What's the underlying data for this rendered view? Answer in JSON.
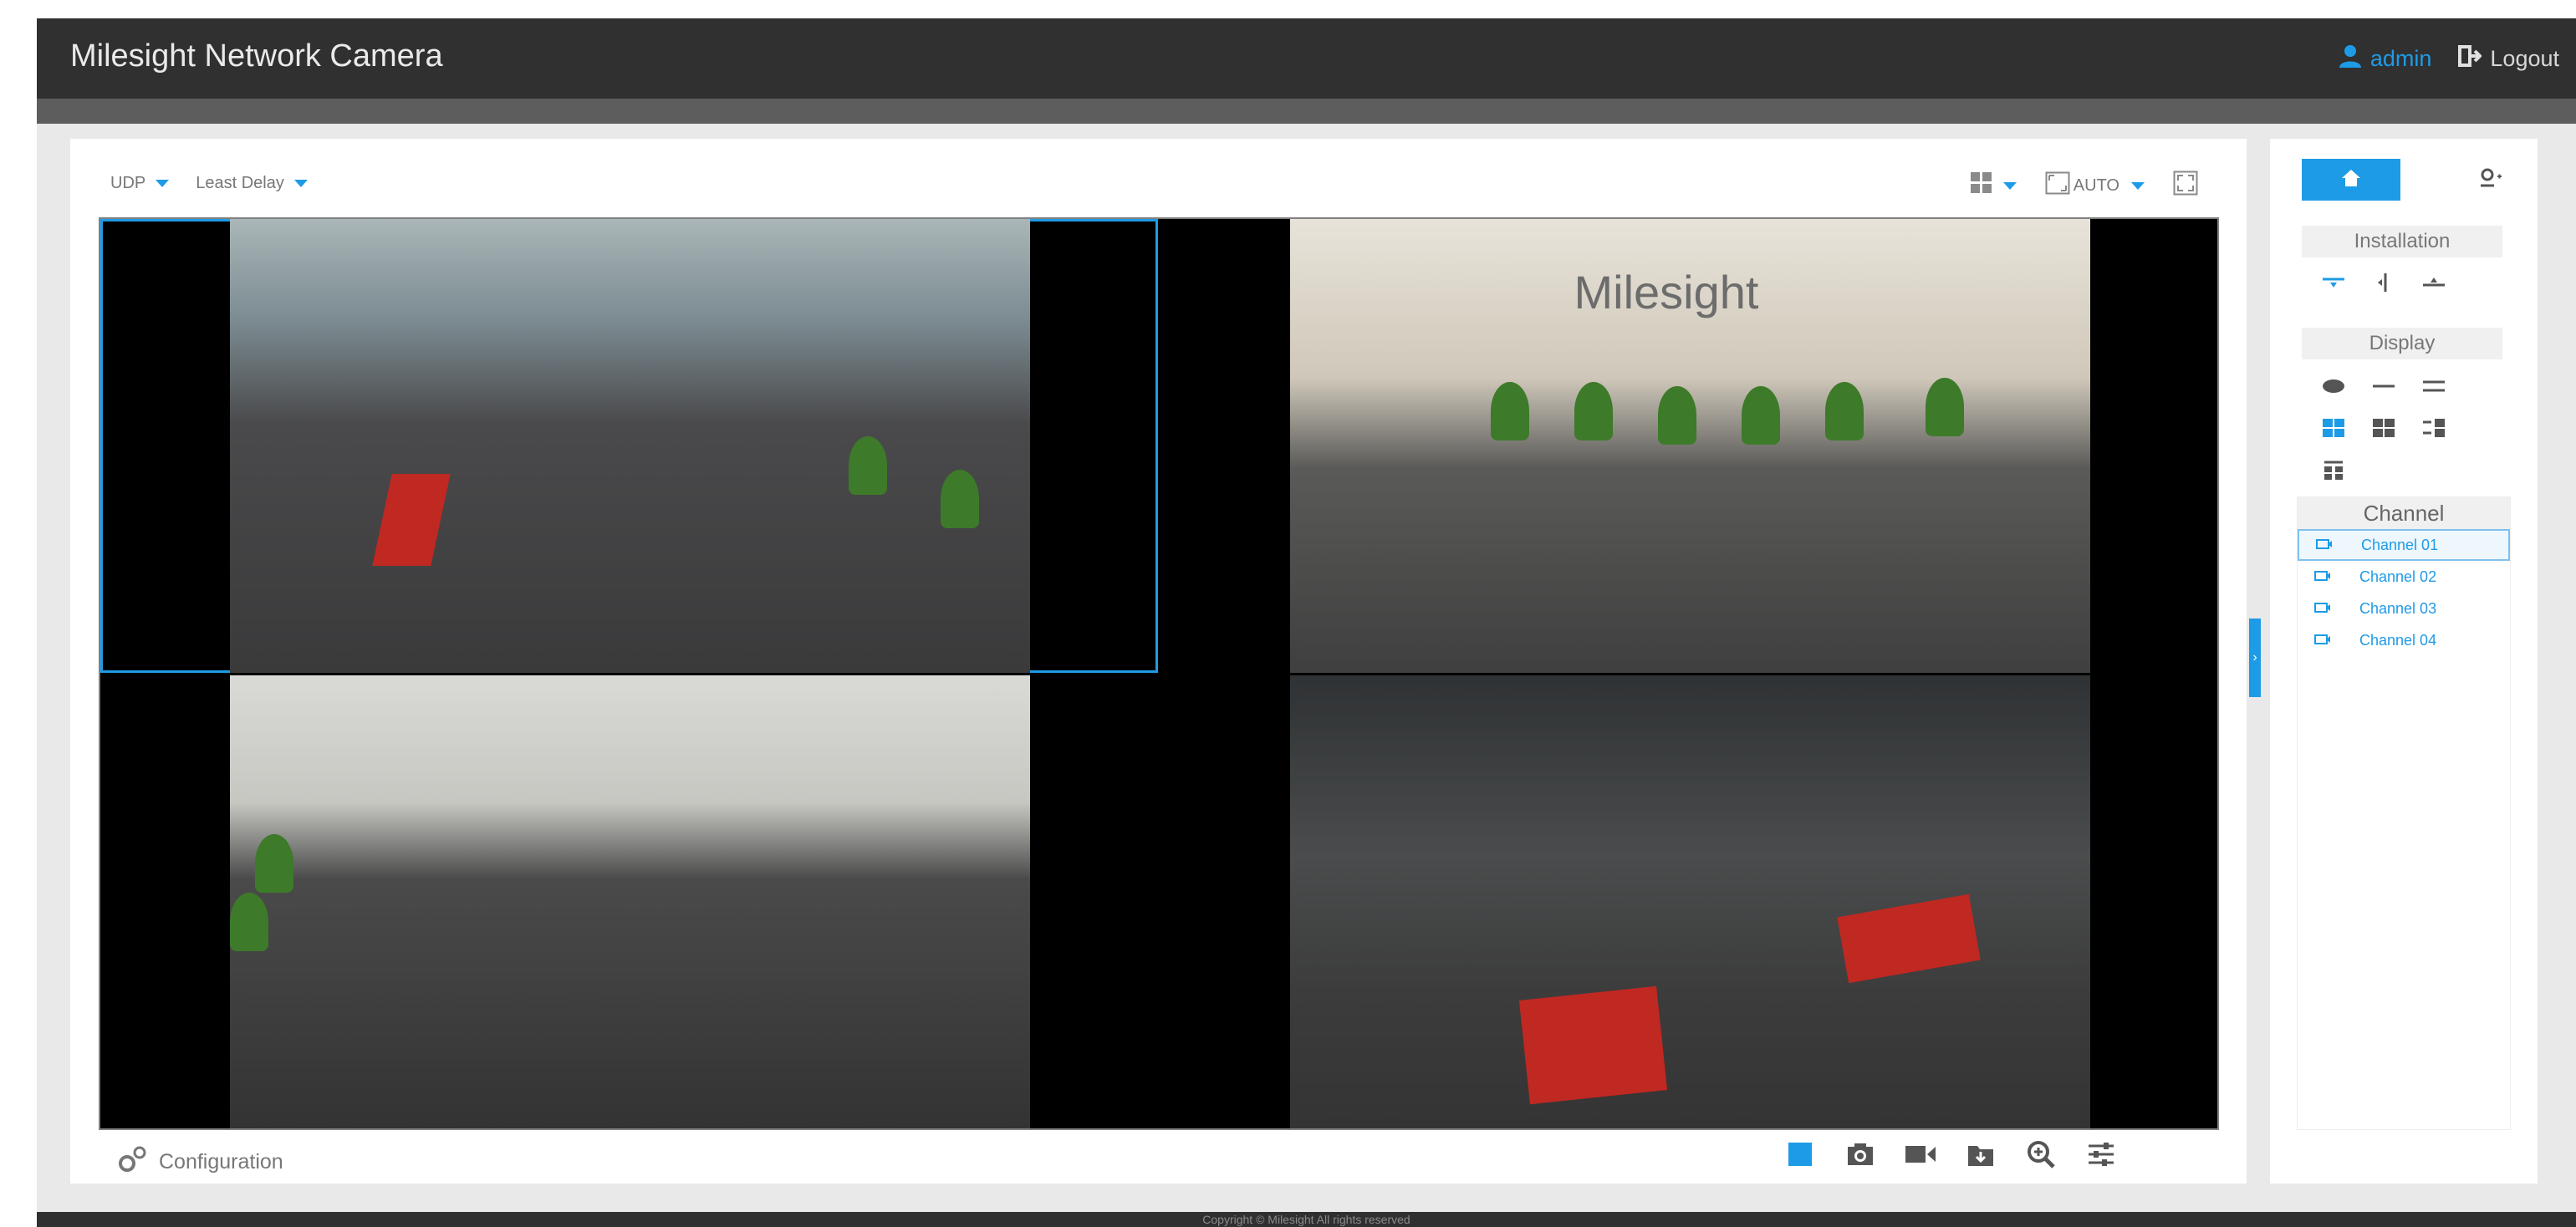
{
  "header": {
    "title": "Milesight Network Camera",
    "user_label": "admin",
    "logout_label": "Logout"
  },
  "toolbar": {
    "protocol": "UDP",
    "delay_mode": "Least Delay",
    "scale_mode": "AUTO"
  },
  "feeds": [
    {
      "channel": "Channel 01",
      "selected": true
    },
    {
      "channel": "Channel 02",
      "selected": false
    },
    {
      "channel": "Channel 03",
      "selected": false
    },
    {
      "channel": "Channel 04",
      "selected": false
    }
  ],
  "wall_logo": "Milesight",
  "bottom": {
    "config_label": "Configuration",
    "tools": [
      "stop-icon",
      "snapshot-icon",
      "record-icon",
      "download-icon",
      "zoom-in-icon",
      "settings-sliders-icon"
    ]
  },
  "side": {
    "installation_label": "Installation",
    "display_label": "Display",
    "channel_label": "Channel",
    "channels": [
      "Channel 01",
      "Channel 02",
      "Channel 03",
      "Channel 04"
    ],
    "selected_channel": "Channel 01"
  },
  "footer": {
    "copyright": "Copyright © Milesight All rights reserved"
  },
  "colors": {
    "accent": "#1e9be6",
    "header_bg": "#303030",
    "panel_bg": "#e9e9e9"
  }
}
